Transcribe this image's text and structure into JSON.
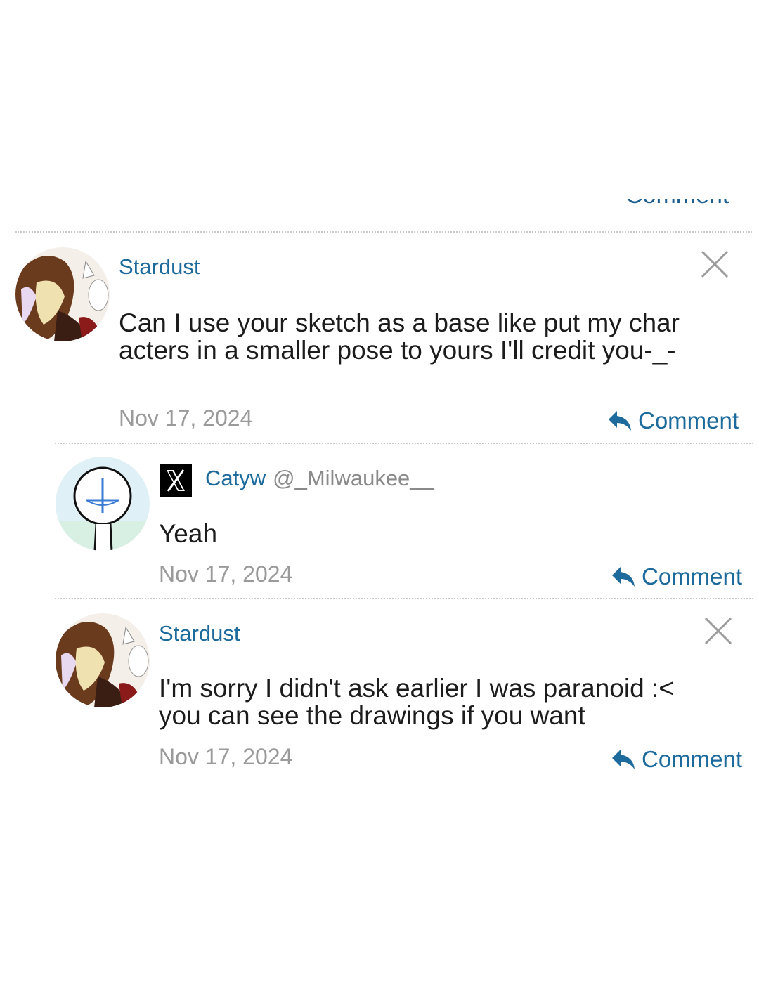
{
  "cutoff_label": "Comment",
  "comments": [
    {
      "author": "Stardust",
      "text": "Can I use your sketch as a base like put my characters in a smaller pose to yours I'll credit you-_-",
      "date": "Nov 17, 2024",
      "action_label": "Comment"
    },
    {
      "author": "Catyw",
      "handle": "@_Milwaukee__",
      "text": "Yeah",
      "date": "Nov 17, 2024",
      "action_label": "Comment"
    },
    {
      "author": "Stardust",
      "text": "I'm sorry I didn't ask earlier I was paranoid :< you can see the drawings if you want",
      "date": "Nov 17, 2024",
      "action_label": "Comment"
    }
  ],
  "icons": {
    "close": "close-icon",
    "reply": "reply-arrow-icon",
    "x_logo": "x-logo-icon"
  },
  "colors": {
    "link": "#1d6a9c",
    "muted": "#9a9a9a",
    "text": "#1c1c1c"
  }
}
